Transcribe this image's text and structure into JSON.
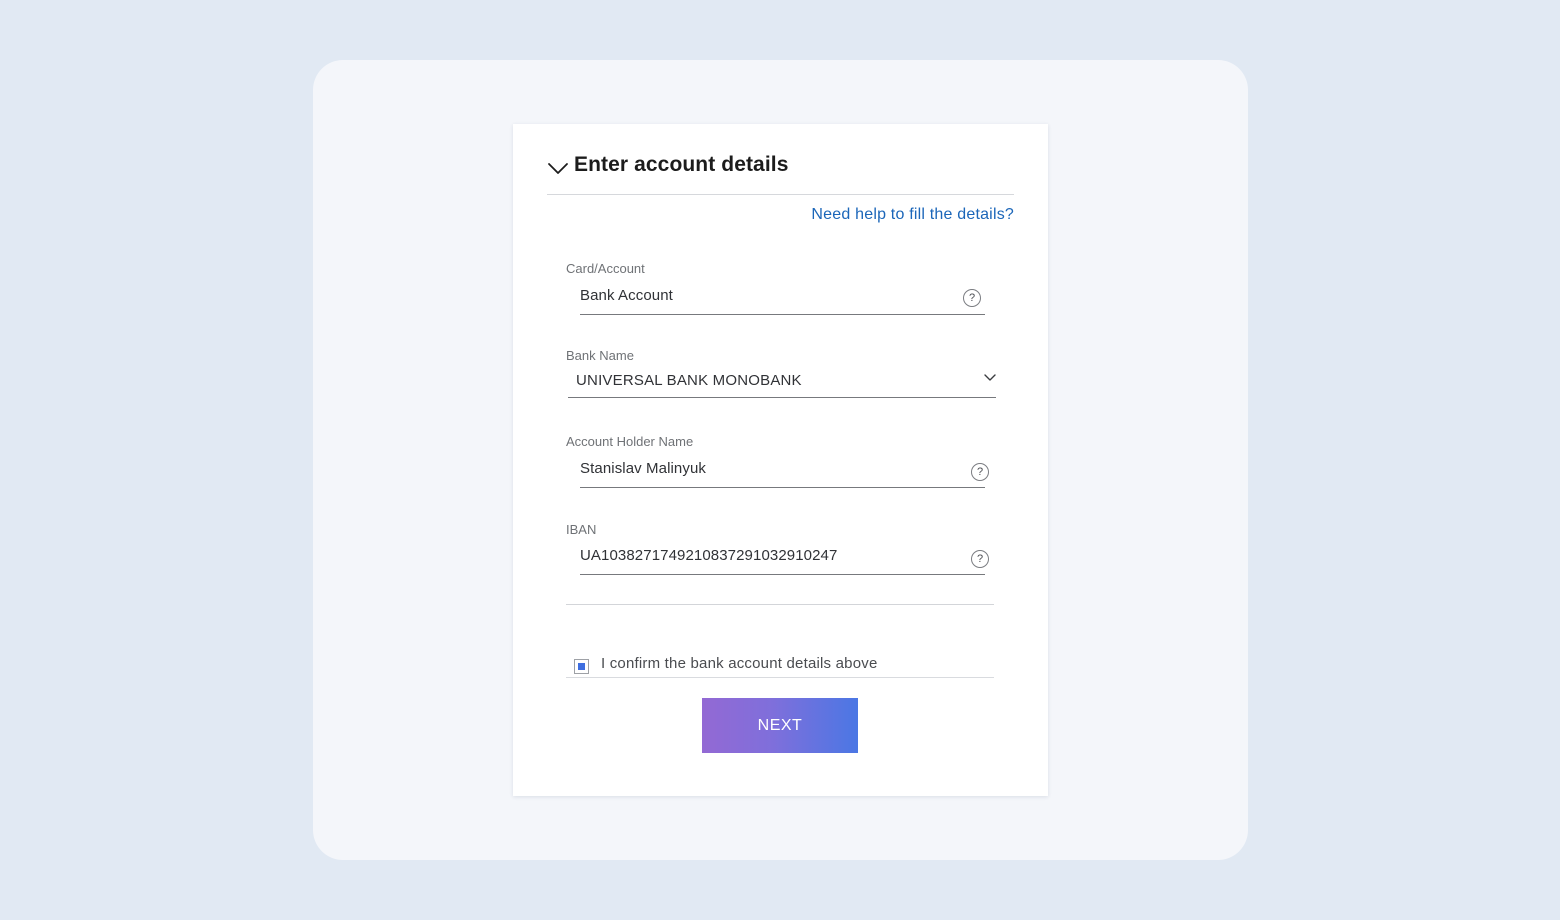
{
  "form": {
    "title": "Enter account details",
    "help_link": "Need help to fill the details?",
    "fields": {
      "card_account": {
        "label": "Card/Account",
        "value": "Bank Account"
      },
      "bank_name": {
        "label": "Bank Name",
        "value": "UNIVERSAL BANK MONOBANK"
      },
      "account_holder": {
        "label": "Account Holder Name",
        "value": "Stanislav Malinyuk"
      },
      "iban": {
        "label": "IBAN",
        "value": "UA103827174921083729103291024​7"
      }
    },
    "info_icon_glyph": "?",
    "confirm": {
      "label": "I confirm the bank account details above",
      "checked": true
    },
    "next_label": "NEXT"
  },
  "icons": {
    "collapse": "chevron-down-icon",
    "info": "question-circle-icon",
    "select": "chevron-down-icon"
  },
  "colors": {
    "page_background": "#e1e9f3",
    "panel_background": "#f4f6fa",
    "card_background": "#ffffff",
    "link": "#1b66b9",
    "button_gradient_start": "#9369d4",
    "button_gradient_end": "#4b77e4",
    "checkbox_accent": "#3f6ee0"
  }
}
